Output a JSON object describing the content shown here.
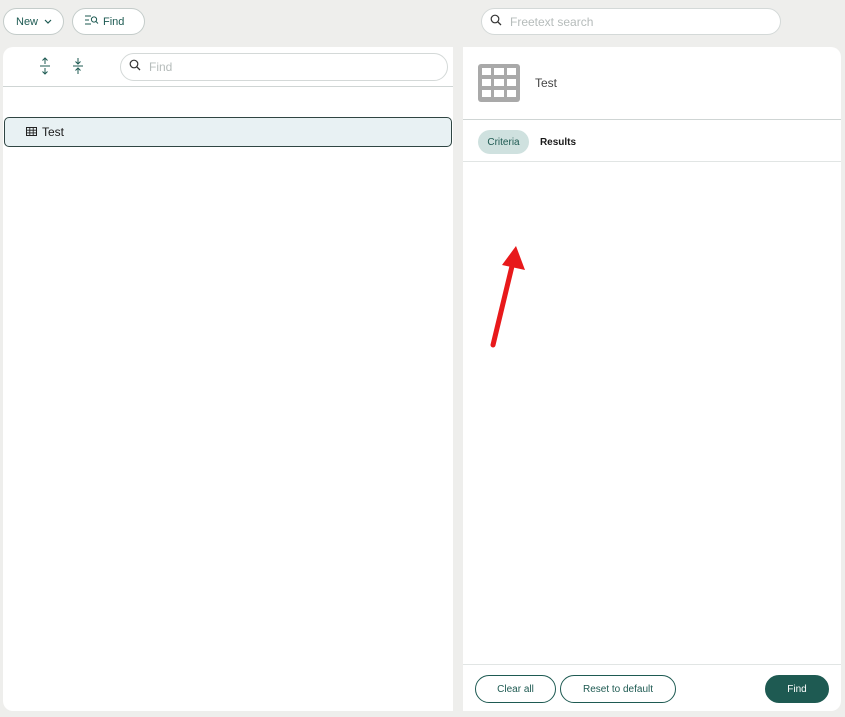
{
  "toolbar": {
    "new_label": "New",
    "find_label": "Find",
    "freetext_placeholder": "Freetext search"
  },
  "left": {
    "search_placeholder": "Find",
    "tree_items": [
      {
        "label": "Test",
        "icon": "table-icon"
      }
    ]
  },
  "right": {
    "title": "Test",
    "tabs": [
      {
        "label": "Criteria",
        "active": true
      },
      {
        "label": "Results",
        "active": false
      }
    ],
    "footer": {
      "clear_label": "Clear all",
      "reset_label": "Reset to default",
      "find_label": "Find"
    }
  },
  "colors": {
    "accent": "#1e5a52",
    "selected_bg": "#e8f1f3",
    "active_tab_bg": "#cfe1df",
    "page_bg": "#eeeeec",
    "annotation_arrow": "#e8191b"
  }
}
